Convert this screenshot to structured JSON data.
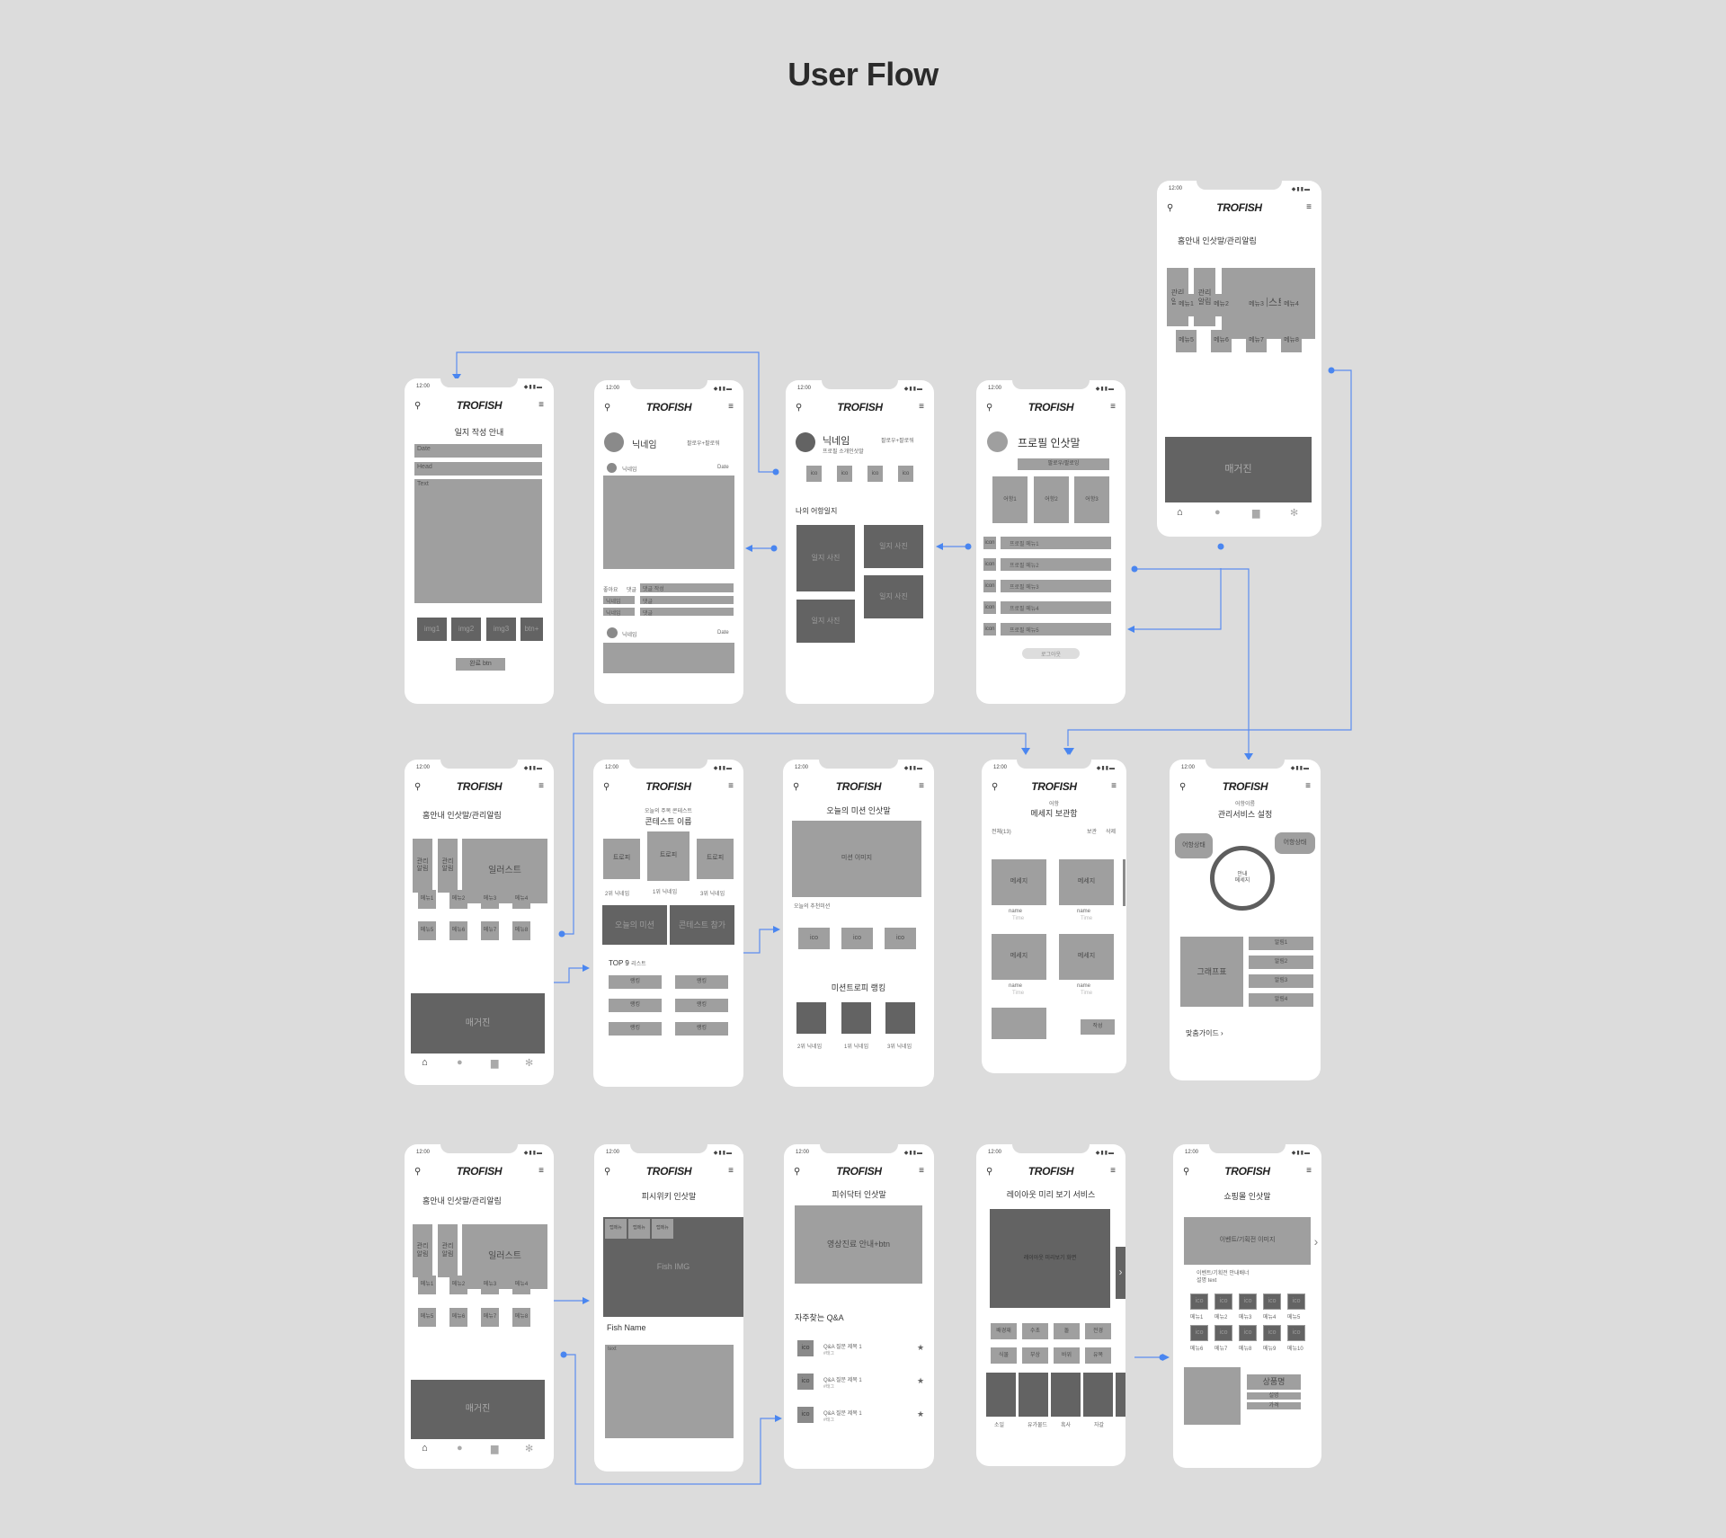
{
  "title": "User Flow",
  "common": {
    "time": "12:00",
    "logo": "TROFISH",
    "status_icons": "wifi-signal-battery",
    "search_icon": "search-icon",
    "menu_icon": "hamburger-icon"
  },
  "screens": {
    "home": {
      "greeting": "홈안내 인삿말/관리알림",
      "alert1": "관리\n알림",
      "alert2": "관리\n알림",
      "illust": "일러스트",
      "menus": [
        "메뉴1",
        "메뉴2",
        "메뉴3",
        "메뉴4",
        "메뉴5",
        "메뉴6",
        "메뉴7",
        "메뉴8"
      ],
      "magazine": "매거진"
    },
    "diary_write": {
      "heading": "일지 작성 안내",
      "date": "Date",
      "head": "Head",
      "text": "Text",
      "imgs": [
        "img1",
        "img2",
        "img3",
        "btn+"
      ],
      "done": "완료 btn"
    },
    "feed": {
      "nick": "닉네임",
      "follow": "팔로우+팔로워",
      "nick_small": "닉네임",
      "date": "Date",
      "like": "좋아요",
      "comment": "댓글",
      "comment_write": "댓글 작성",
      "c1_nick": "닉네임",
      "c1_text": "댓글",
      "c2_nick": "닉네임",
      "c2_text": "댓글",
      "nick2": "닉네임",
      "date2": "Date"
    },
    "mypage": {
      "nick": "닉네임",
      "follow": "팔로우+팔로워",
      "intro": "프로필 소개인삿말",
      "ico": [
        "ico",
        "ico",
        "ico",
        "ico"
      ],
      "section": "나의 어항일지",
      "photos": [
        "일지 사진",
        "일지 사진",
        "일지 사진",
        "일지 사진"
      ]
    },
    "profile": {
      "greeting": "프로필 인삿말",
      "follow_btn": "팔로우/팔로잉",
      "tanks": [
        "어항1",
        "어항2",
        "어항3"
      ],
      "icon_label": "icon",
      "menus": [
        "프로필 메뉴1",
        "프로필 메뉴2",
        "프로필 메뉴3",
        "프로필 메뉴4",
        "프로필 메뉴5"
      ],
      "logout": "로그아웃"
    },
    "contest": {
      "sub": "오늘의 주목 콘테스트",
      "name": "콘테스트 이름",
      "trophies": [
        "트로피",
        "트로피",
        "트로피"
      ],
      "ranks": [
        "2위 닉네임",
        "1위 닉네임",
        "3위 닉네임"
      ],
      "mission_btn": "오늘의 미션",
      "contest_btn": "콘테스트 참가",
      "top9": "TOP 9",
      "top9_sub": "리스트",
      "rank_label": "랭킹"
    },
    "mission": {
      "greeting": "오늘의 미션 인삿말",
      "image": "미션 이미지",
      "recommend": "오늘의 추천미션",
      "ico": [
        "ico",
        "ico",
        "ico"
      ],
      "ranking": "미션트로피 랭킹",
      "ranks": [
        "2위 닉네임",
        "1위 닉네임",
        "3위 닉네임"
      ]
    },
    "messages": {
      "sub": "어항",
      "title": "메세지 보관함",
      "all": "전체(13)",
      "edit": "보관",
      "delete": "삭제",
      "msg": "메세지",
      "name": "name",
      "time": "Time",
      "write": "작성"
    },
    "manage": {
      "sub": "어항이름",
      "title": "관리서비스 설정",
      "state_l": "어항상태",
      "state_r": "어항상태",
      "center": "안내\n메세지",
      "graph": "그래프표",
      "alarms": [
        "알림1",
        "알림2",
        "알림3",
        "알림4"
      ],
      "guide": "맞춤가이드 ›"
    },
    "fishwiki": {
      "greeting": "피시위키 인삿말",
      "tabs": [
        "탭메뉴",
        "탭메뉴",
        "탭메뉴"
      ],
      "img": "Fish IMG",
      "name": "Fish Name",
      "text": "text"
    },
    "fishdoctor": {
      "greeting": "피쉬닥터 인삿말",
      "video": "영상진료 안내+btn",
      "faq": "자주찾는 Q&A",
      "ico": "ico",
      "q": "Q&A 질문 제목 1",
      "tag": "#태그"
    },
    "layout": {
      "greeting": "레이아웃 미리 보기 서비스",
      "preview": "레이아웃 미리보기 화면",
      "chips": [
        "배경재",
        "수초",
        "돌",
        "전경",
        "식물",
        "부상",
        "바위",
        "유목"
      ],
      "items": [
        "소일",
        "유가물드",
        "흑사",
        "자갈"
      ]
    },
    "shop": {
      "greeting": "쇼핑몰 인삿말",
      "banner": "이벤트/기획전 이미지",
      "banner_text": "이벤트/기획전 안내배너",
      "banner_sub": "설명 text",
      "ico": "ico",
      "menus": [
        "메뉴1",
        "메뉴2",
        "메뉴3",
        "메뉴4",
        "메뉴5",
        "메뉴6",
        "메뉴7",
        "메뉴8",
        "메뉴9",
        "메뉴10"
      ],
      "product": "상품명",
      "desc": "설명",
      "price": "가격"
    }
  }
}
